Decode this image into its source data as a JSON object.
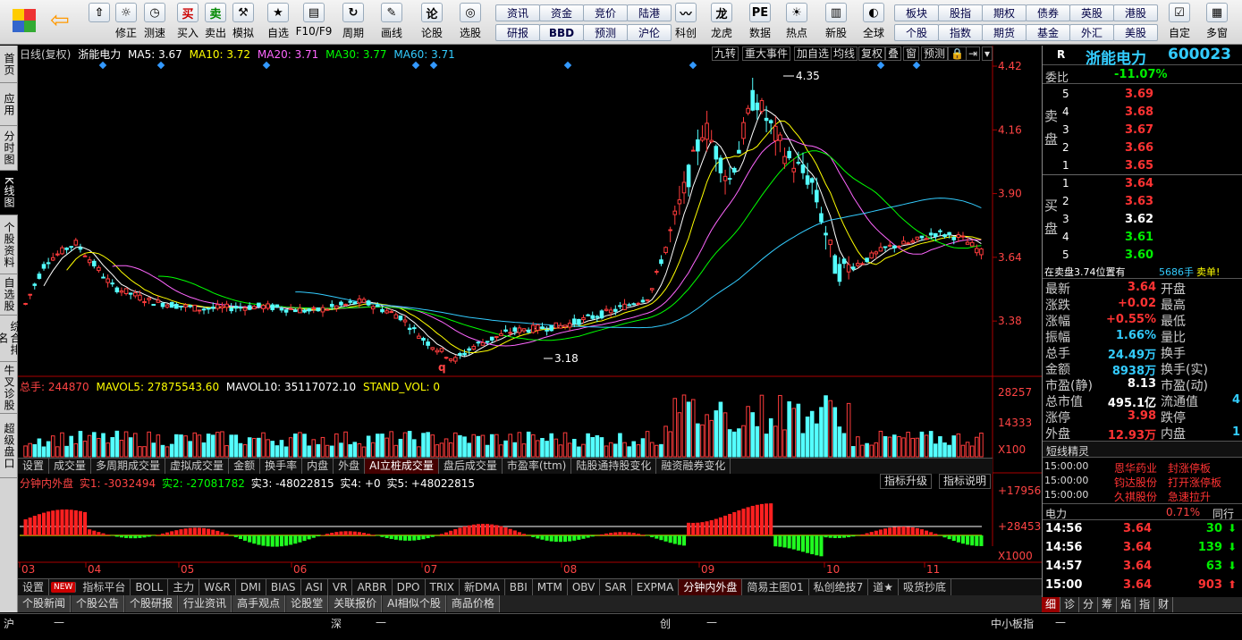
{
  "toolbar": {
    "buttons": [
      {
        "name": "up-button",
        "icon": "up-arrow-icon",
        "label": ""
      },
      {
        "name": "modify-button",
        "icon": "coin-icon",
        "label": "修正"
      },
      {
        "name": "measure-button",
        "icon": "clock-icon",
        "label": "测速"
      },
      {
        "name": "buy-button",
        "icon": "buy-icon",
        "glyph": "买",
        "label": "买入"
      },
      {
        "name": "sell-button",
        "icon": "sell-icon",
        "glyph": "卖",
        "label": "卖出"
      },
      {
        "name": "simulate-button",
        "icon": "hammer-icon",
        "label": "模拟"
      },
      {
        "name": "self-select-button",
        "icon": "star-icon",
        "label": "自选"
      },
      {
        "name": "f10-button",
        "icon": "f10-icon",
        "label": "F10/F9"
      },
      {
        "name": "period-button",
        "icon": "period-icon",
        "label": "周期"
      },
      {
        "name": "draw-button",
        "icon": "pencil-icon",
        "label": "画线"
      },
      {
        "name": "forum-button",
        "icon": "forum-icon",
        "label": "论股"
      },
      {
        "name": "select-stock-button",
        "icon": "chart-select-icon",
        "label": "选股"
      },
      {
        "name": "kechuang-button",
        "icon": "kechuang-icon",
        "label": "科创"
      },
      {
        "name": "dragon-button",
        "icon": "dragon-icon",
        "label": "龙虎"
      },
      {
        "name": "data-button",
        "icon": "pe-icon",
        "label": "数据"
      },
      {
        "name": "hot-button",
        "icon": "hot-icon",
        "label": "热点"
      },
      {
        "name": "new-stock-button",
        "icon": "newstock-icon",
        "label": "新股"
      },
      {
        "name": "global-button",
        "icon": "globe-icon",
        "label": "全球"
      },
      {
        "name": "custom-button",
        "icon": "custom-icon",
        "label": "自定"
      },
      {
        "name": "multi-window-button",
        "icon": "multiwindow-icon",
        "label": "多窗"
      }
    ],
    "grid": [
      [
        "资讯",
        "资金",
        "竞价",
        "陆港"
      ],
      [
        "研报",
        "BBD",
        "预测",
        "沪伦"
      ],
      [
        "板块",
        "股指",
        "期权",
        "债券",
        "英股",
        "港股"
      ],
      [
        "个股",
        "指数",
        "期货",
        "基金",
        "外汇",
        "美股"
      ]
    ]
  },
  "leftnav": [
    "首页",
    "应用",
    "分时图",
    "K线图",
    "个股资料",
    "自选股",
    "综合排名",
    "牛叉诊股",
    "超级盘口"
  ],
  "chart": {
    "header": {
      "prefix": "日线(复权)",
      "name": "浙能电力",
      "ma5": "MA5: 3.67",
      "ma10": "MA10: 3.72",
      "ma20": "MA20: 3.71",
      "ma30": "MA30: 3.77",
      "ma60": "MA60: 3.71",
      "ma5c": "#ffffff",
      "ma10c": "#ffff00",
      "ma20c": "#ff66ff",
      "ma30c": "#00ff00",
      "ma60c": "#33ccff"
    },
    "right_buttons": [
      "九转",
      "重大事件",
      "加自选",
      "均线",
      "复权",
      "叠",
      "窗",
      "预测"
    ],
    "price_ticks": [
      "4.42",
      "4.16",
      "3.90",
      "3.64",
      "3.38"
    ],
    "high_label": "4.35",
    "low_label": "3.18",
    "q_mark": "q",
    "vol_header": {
      "a": "总手: 244870",
      "b": "MAVOL5: 27875543.60",
      "c": "MAVOL10: 35117072.10",
      "d": "STAND_VOL: 0"
    },
    "vol_ticks": [
      "28257",
      "14333",
      "X100"
    ],
    "sub_tabs": [
      "设置",
      "成交量",
      "多周期成交量",
      "虚拟成交量",
      "金额",
      "换手率",
      "内盘",
      "外盘",
      "AI立桩成交量",
      "盘后成交量",
      "市盈率(ttm)",
      "陆股通持股变化",
      "融资融券变化"
    ],
    "ind_header": {
      "a": "分钟内外盘",
      "b": "实1: -3032494",
      "c": "实2: -27081782",
      "d": "实3: -48022815",
      "e": "实4: +0",
      "f": "实5: +48022815"
    },
    "ind_buttons": [
      "指标升级",
      "指标说明"
    ],
    "ind_ticks": [
      "+179562",
      "+28453",
      "X1000"
    ],
    "months": [
      "03",
      "04",
      "05",
      "06",
      "07",
      "08",
      "09",
      "10",
      "11"
    ]
  },
  "indicator_tabs": [
    "设置",
    "NEW",
    "指标平台",
    "BOLL",
    "主力",
    "W&R",
    "DMI",
    "BIAS",
    "ASI",
    "VR",
    "ARBR",
    "DPO",
    "TRIX",
    "新DMA",
    "BBI",
    "MTM",
    "OBV",
    "SAR",
    "EXPMA",
    "分钟内外盘",
    "简易主图01",
    "私创绝技7",
    "道★",
    "吸货抄底"
  ],
  "news_tabs": [
    "个股新闻",
    "个股公告",
    "个股研报",
    "行业资讯",
    "高手观点",
    "论股堂",
    "关联报价",
    "AI相似个股",
    "商品价格"
  ],
  "statusbar": {
    "a": "沪",
    "b": "深",
    "c": "创",
    "d": "中小板指",
    "dash": "—"
  },
  "quote": {
    "rmark": "R",
    "name": "浙能电力",
    "code": "600023",
    "weibi_label": "委比",
    "weibi": "-11.07%",
    "sell_label": "卖盘",
    "buy_label": "买盘",
    "asks": [
      [
        "5",
        "3.69"
      ],
      [
        "4",
        "3.68"
      ],
      [
        "3",
        "3.67"
      ],
      [
        "2",
        "3.66"
      ],
      [
        "1",
        "3.65"
      ]
    ],
    "bids": [
      [
        "1",
        "3.64"
      ],
      [
        "2",
        "3.63"
      ],
      [
        "3",
        "3.62"
      ],
      [
        "4",
        "3.61"
      ],
      [
        "5",
        "3.60"
      ]
    ],
    "info": {
      "a": "在卖盘3.74位置有",
      "b": "5686手",
      "c": "卖单!"
    },
    "stats_left": [
      [
        "最新",
        "3.64"
      ],
      [
        "涨跌",
        "+0.02"
      ],
      [
        "涨幅",
        "+0.55%"
      ],
      [
        "振幅",
        "1.66%"
      ],
      [
        "总手",
        "24.49万"
      ],
      [
        "金额",
        "8938万"
      ],
      [
        "市盈(静)",
        "8.13"
      ],
      [
        "总市值",
        "495.1亿"
      ],
      [
        "涨停",
        "3.98"
      ],
      [
        "外盘",
        "12.93万"
      ]
    ],
    "stats_right": [
      "开盘",
      "最高",
      "最低",
      "量比",
      "换手",
      "换手(实)",
      "市盈(动)",
      "流通值",
      "跌停",
      "内盘"
    ],
    "stats_right_vals": [
      "",
      "",
      "",
      "",
      "",
      "",
      "",
      "4",
      "",
      "1"
    ],
    "short_title": "短线精灵",
    "short": [
      [
        "15:00:00",
        "恩华药业",
        "封涨停板"
      ],
      [
        "15:00:00",
        "钧达股份",
        "打开涨停板"
      ],
      [
        "15:00:00",
        "久祺股份",
        "急速拉升"
      ]
    ],
    "ticker": {
      "name": "电力",
      "pct": "0.71%",
      "more": "同行"
    },
    "ticks": [
      [
        "14:56",
        "3.64",
        "30"
      ],
      [
        "14:56",
        "3.64",
        "139"
      ],
      [
        "14:57",
        "3.64",
        "63"
      ],
      [
        "15:00",
        "3.64",
        "903"
      ]
    ],
    "bottom_tabs": [
      "细",
      "诊",
      "分",
      "筹",
      "焰",
      "指",
      "财"
    ]
  }
}
